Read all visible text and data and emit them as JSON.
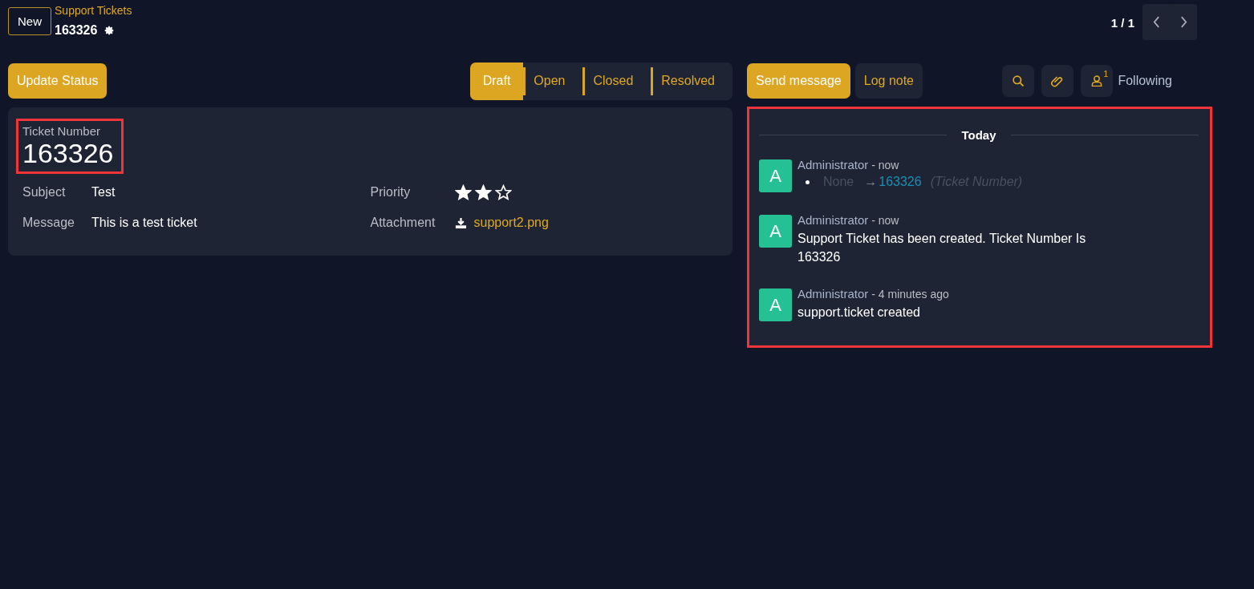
{
  "header": {
    "new_button": "New",
    "breadcrumb": "Support Tickets",
    "record": "163326",
    "pager": "1 / 1"
  },
  "actions": {
    "update_button": "Update Status",
    "stages": [
      {
        "label": "Draft",
        "selected": true
      },
      {
        "label": "Open",
        "selected": false
      },
      {
        "label": "Closed",
        "selected": false
      },
      {
        "label": "Resolved",
        "selected": false
      }
    ]
  },
  "form": {
    "highlighted": true,
    "title_label": "Ticket Number",
    "title_value": "163326",
    "left_fields": [
      {
        "label": "Subject",
        "value": "Test"
      },
      {
        "label": "Message",
        "value": "This is a test ticket"
      }
    ],
    "priority": {
      "label": "Priority",
      "stars": 2
    },
    "attachment": {
      "label": "Attachment",
      "file": "support2.png"
    }
  },
  "chatter": {
    "send_button": "Send message",
    "log_button": "Log note",
    "follower_count": "1",
    "following": "Following",
    "highlighted": true,
    "date_separator": "Today",
    "messages": [
      {
        "kind": "tracking",
        "avatar": "A",
        "author": "Administrator",
        "time": " - now",
        "old_value": "None",
        "arrow": "→",
        "new_value": "163326",
        "field": "(Ticket Number)"
      },
      {
        "kind": "text",
        "avatar": "A",
        "author": "Administrator",
        "time": " - now",
        "body": "Support Ticket has been created. Ticket Number Is 163326"
      },
      {
        "kind": "text",
        "avatar": "A",
        "author": "Administrator",
        "time": " - 4 minutes ago",
        "body": "support.ticket created"
      }
    ]
  }
}
